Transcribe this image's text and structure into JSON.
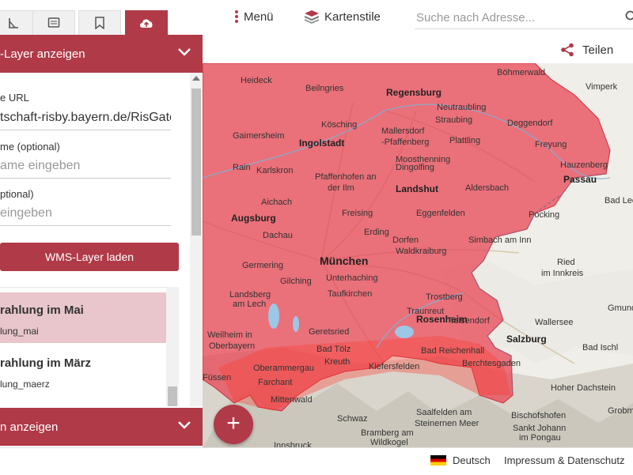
{
  "toolbar": {
    "menu_label": "Menü",
    "styles_label": "Kartenstile",
    "search_placeholder": "Suche nach Adresse..."
  },
  "share": {
    "label": "Teilen"
  },
  "sidebar": {
    "tabs": [
      "draw-icon",
      "notes-icon",
      "bookmark-icon",
      "upload-cloud-icon"
    ],
    "active_tab": 3,
    "wms_header": "-Layer anzeigen",
    "form": {
      "url_label": "e URL",
      "url_value": "tschaft-risby.bayern.de/RisGate",
      "name_label": "me (optional)",
      "name_placeholder": "ame eingeben",
      "third_label": "ptional)",
      "third_placeholder": "eingeben",
      "load_button": "WMS-Layer laden"
    },
    "layers": [
      {
        "title": "rahlung im Mai",
        "subtitle": "lung_mai",
        "selected": true
      },
      {
        "title": "rahlung im März",
        "subtitle": "lung_maerz",
        "selected": false
      }
    ],
    "legend_header": "n anzeigen"
  },
  "map": {
    "overlay_color": "#e8404f",
    "cities": [
      {
        "name": "Regensburg",
        "cls": "mid"
      },
      {
        "name": "Ingolstadt",
        "cls": "mid"
      },
      {
        "name": "Augsburg",
        "cls": "mid"
      },
      {
        "name": "Landshut",
        "cls": "mid"
      },
      {
        "name": "München",
        "cls": "big"
      },
      {
        "name": "Rosenheim",
        "cls": "mid"
      },
      {
        "name": "Passau",
        "cls": "mid"
      },
      {
        "name": "Salzburg",
        "cls": "mid"
      },
      {
        "name": "Straubing",
        "cls": ""
      },
      {
        "name": "Deggendorf",
        "cls": ""
      },
      {
        "name": "Neutraubling",
        "cls": ""
      },
      {
        "name": "Mallersdorf",
        "cls": ""
      },
      {
        "name": "-Pfaffenberg",
        "cls": ""
      },
      {
        "name": "Plattling",
        "cls": ""
      },
      {
        "name": "Freyung",
        "cls": ""
      },
      {
        "name": "Hauzenberg",
        "cls": ""
      },
      {
        "name": "Moosthenning",
        "cls": ""
      },
      {
        "name": "Dingolfing",
        "cls": ""
      },
      {
        "name": "Pfaffenhofen an",
        "cls": ""
      },
      {
        "name": "der Ilm",
        "cls": ""
      },
      {
        "name": "Aldersbach",
        "cls": ""
      },
      {
        "name": "Freising",
        "cls": ""
      },
      {
        "name": "Eggenfelden",
        "cls": ""
      },
      {
        "name": "Pocking",
        "cls": ""
      },
      {
        "name": "Erding",
        "cls": ""
      },
      {
        "name": "Dorfen",
        "cls": ""
      },
      {
        "name": "Simbach am Inn",
        "cls": ""
      },
      {
        "name": "Waldkraiburg",
        "cls": ""
      },
      {
        "name": "Germering",
        "cls": ""
      },
      {
        "name": "Gilching",
        "cls": ""
      },
      {
        "name": "Unterhaching",
        "cls": ""
      },
      {
        "name": "Taufkirchen",
        "cls": ""
      },
      {
        "name": "Landsberg",
        "cls": ""
      },
      {
        "name": "am Lech",
        "cls": ""
      },
      {
        "name": "Traunreut",
        "cls": ""
      },
      {
        "name": "Trostberg",
        "cls": ""
      },
      {
        "name": "Teisendorf",
        "cls": ""
      },
      {
        "name": "Geretsried",
        "cls": ""
      },
      {
        "name": "Bad Tölz",
        "cls": ""
      },
      {
        "name": "Bad Reichenhall",
        "cls": ""
      },
      {
        "name": "Berchtesgaden",
        "cls": ""
      },
      {
        "name": "Oberammergau",
        "cls": ""
      },
      {
        "name": "Kreuth",
        "cls": ""
      },
      {
        "name": "Kiefersfelden",
        "cls": ""
      },
      {
        "name": "Farchant",
        "cls": ""
      },
      {
        "name": "Mittenwald",
        "cls": ""
      },
      {
        "name": "Schwaz",
        "cls": ""
      },
      {
        "name": "Saalfelden am",
        "cls": ""
      },
      {
        "name": "Steinernen Meer",
        "cls": ""
      },
      {
        "name": "Bischofshofen",
        "cls": ""
      },
      {
        "name": "Sankt Johann",
        "cls": ""
      },
      {
        "name": "im Pongau",
        "cls": ""
      },
      {
        "name": "Bad Ischl",
        "cls": ""
      },
      {
        "name": "Ried",
        "cls": ""
      },
      {
        "name": "im Innkreis",
        "cls": ""
      },
      {
        "name": "Wallersee",
        "cls": ""
      },
      {
        "name": "Gmund",
        "cls": ""
      },
      {
        "name": "Bad Leo",
        "cls": ""
      },
      {
        "name": "Vimperk",
        "cls": ""
      },
      {
        "name": "Böhmerwald",
        "cls": ""
      },
      {
        "name": "Heideck",
        "cls": ""
      },
      {
        "name": "Beilngries",
        "cls": ""
      },
      {
        "name": "Gaimersheim",
        "cls": ""
      },
      {
        "name": "Kösching",
        "cls": ""
      },
      {
        "name": "Rain",
        "cls": ""
      },
      {
        "name": "Karlskron",
        "cls": ""
      },
      {
        "name": "Aichach",
        "cls": ""
      },
      {
        "name": "Dachau",
        "cls": ""
      },
      {
        "name": "Weilheim in",
        "cls": ""
      },
      {
        "name": "Oberbayern",
        "cls": ""
      },
      {
        "name": "Füssen",
        "cls": ""
      },
      {
        "name": "Grobmin",
        "cls": ""
      },
      {
        "name": "Hoher Dachstein",
        "cls": ""
      },
      {
        "name": "Bramberg am",
        "cls": ""
      },
      {
        "name": "Wildkogel",
        "cls": ""
      },
      {
        "name": "Innsbruck",
        "cls": ""
      }
    ]
  },
  "footer": {
    "language": "Deutsch",
    "impressum": "Impressum & Datenschutz"
  }
}
